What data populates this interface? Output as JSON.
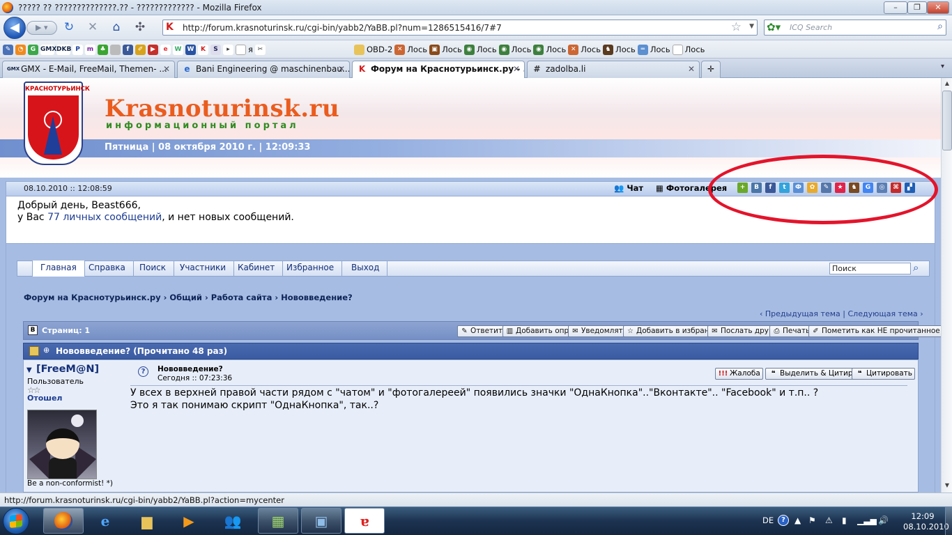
{
  "window": {
    "title": "????? ?? ??????????????.?? - ????????????? - Mozilla Firefox",
    "controls": [
      "–",
      "❐",
      "✕"
    ]
  },
  "nav": {
    "url": "http://forum.krasnoturinsk.ru/cgi-bin/yabb2/YaBB.pl?num=1286515416/7#7",
    "search_placeholder": "ICQ Search"
  },
  "bookmarks": {
    "icons": [
      "GMX",
      "DKB",
      "P",
      "m"
    ],
    "items": [
      {
        "label": "OBD-2"
      },
      {
        "label": "Лось"
      },
      {
        "label": "Лось"
      },
      {
        "label": "Лось"
      },
      {
        "label": "Лось"
      },
      {
        "label": "Лось"
      },
      {
        "label": "Лось"
      },
      {
        "label": "Лось"
      },
      {
        "label": "Лось"
      },
      {
        "label": "Лось"
      }
    ],
    "prefix": "я"
  },
  "tabs": [
    {
      "label": "GMX - E-Mail, FreeMail, Themen- ...",
      "icon": "GMX"
    },
    {
      "label": "Bani Engineering @ maschinenbau....",
      "icon": "e"
    },
    {
      "label": "Форум на Краснотурьинск.ру - ...",
      "icon": "K",
      "active": true
    },
    {
      "label": "zadolba.li",
      "icon": "#"
    }
  ],
  "header": {
    "crest_text": "КРАСНОТУРЬИНСК",
    "logo": "Krasnoturinsk.ru",
    "tagline": "информационный портал",
    "date_line": "Пятница | 08 октября 2010 г. | 12:09:33"
  },
  "info": {
    "datetime": "08.10.2010 :: 12:08:59",
    "chat": "Чат",
    "gallery": "Фотогалерея",
    "greeting": "Добрый день, Beast666,",
    "msg_prefix": "у Вас ",
    "msg_link": "77 личных сообщений",
    "msg_suffix": ", и нет новых сообщений.",
    "share_icons": [
      {
        "g": "+",
        "c": "#6aa82a"
      },
      {
        "g": "B",
        "c": "#4a76a8"
      },
      {
        "g": "f",
        "c": "#3b5998"
      },
      {
        "g": "t",
        "c": "#33a3dc"
      },
      {
        "g": "Ф",
        "c": "#5a8fd6"
      },
      {
        "g": "✿",
        "c": "#e9a92b"
      },
      {
        "g": "✎",
        "c": "#5577aa"
      },
      {
        "g": "★",
        "c": "#e0244a"
      },
      {
        "g": "♞",
        "c": "#7a4a22"
      },
      {
        "g": "G",
        "c": "#4285f4"
      },
      {
        "g": "◎",
        "c": "#5c7fb5"
      },
      {
        "g": "⌘",
        "c": "#c42a2a"
      },
      {
        "g": "▞",
        "c": "#1f5fb5"
      }
    ]
  },
  "menu": {
    "items": [
      "Главная",
      "Справка",
      "Поиск",
      "Участники",
      "Кабинет",
      "Избранное",
      "Выход"
    ],
    "search": "Поиск"
  },
  "breadcrumb": "Форум на Краснотурьинск.ру › Общий › Работа сайта › Нововведение?",
  "prevnext": {
    "prev": "‹ Предыдущая тема",
    "sep": "|",
    "next": "Следующая тема ›"
  },
  "toolbar": {
    "pages": "Страниц: 1",
    "buttons": [
      "Ответить",
      "Добавить опрос",
      "Уведомлять",
      "Добавить в избранное",
      "Послать другу",
      "Печать",
      "Пометить как НЕ прочитанное"
    ]
  },
  "topic": {
    "title": "Нововведение? (Прочитано 48 раз)"
  },
  "post": {
    "author": "[FreeM@N]",
    "role": "Пользователь",
    "stars": "☆☆",
    "rank": "Отошел",
    "motto": "Be a non-conformist! *)",
    "subject": "Нововведение?",
    "date": "Сегодня :: 07:23:36",
    "buttons": [
      "Жалоба",
      "Выделить & Цитировать",
      "Цитировать"
    ],
    "line1": "У всех  в верхней правой части рядом с \"чатом\" и \"фотогалереей\" появились значки \"ОднаКнопка\"..\"Вконтакте\".. \"Facebook\" и т.п.. ?",
    "line2": "Это я так понимаю скрипт \"ОднаКнопка\", так..?"
  },
  "status": "http://forum.krasnoturinsk.ru/cgi-bin/yabb2/YaBB.pl?action=mycenter",
  "tray": {
    "lang": "DE",
    "time": "12:09",
    "date": "08.10.2010"
  },
  "colors": {
    "annotation_ring": "#e3142b",
    "accent": "#142f78",
    "logo": "#ea5c1e"
  }
}
